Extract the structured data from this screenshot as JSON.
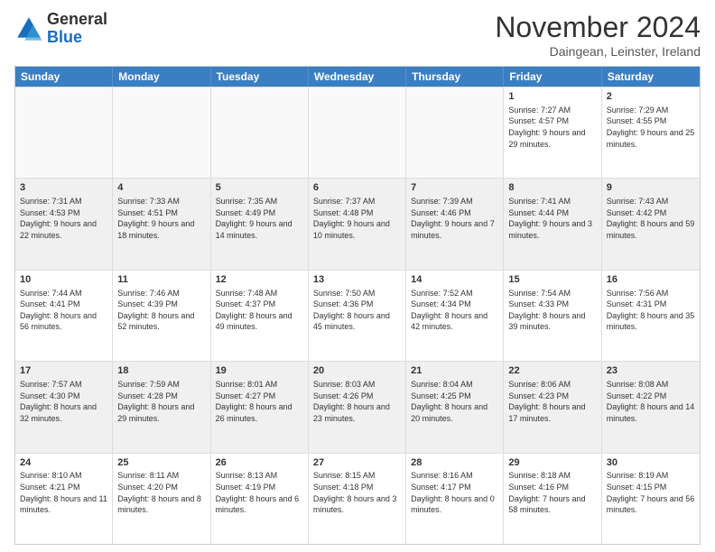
{
  "logo": {
    "general": "General",
    "blue": "Blue"
  },
  "header": {
    "month": "November 2024",
    "location": "Daingean, Leinster, Ireland"
  },
  "days": [
    "Sunday",
    "Monday",
    "Tuesday",
    "Wednesday",
    "Thursday",
    "Friday",
    "Saturday"
  ],
  "rows": [
    [
      {
        "day": "",
        "info": ""
      },
      {
        "day": "",
        "info": ""
      },
      {
        "day": "",
        "info": ""
      },
      {
        "day": "",
        "info": ""
      },
      {
        "day": "",
        "info": ""
      },
      {
        "day": "1",
        "info": "Sunrise: 7:27 AM\nSunset: 4:57 PM\nDaylight: 9 hours and 29 minutes."
      },
      {
        "day": "2",
        "info": "Sunrise: 7:29 AM\nSunset: 4:55 PM\nDaylight: 9 hours and 25 minutes."
      }
    ],
    [
      {
        "day": "3",
        "info": "Sunrise: 7:31 AM\nSunset: 4:53 PM\nDaylight: 9 hours and 22 minutes."
      },
      {
        "day": "4",
        "info": "Sunrise: 7:33 AM\nSunset: 4:51 PM\nDaylight: 9 hours and 18 minutes."
      },
      {
        "day": "5",
        "info": "Sunrise: 7:35 AM\nSunset: 4:49 PM\nDaylight: 9 hours and 14 minutes."
      },
      {
        "day": "6",
        "info": "Sunrise: 7:37 AM\nSunset: 4:48 PM\nDaylight: 9 hours and 10 minutes."
      },
      {
        "day": "7",
        "info": "Sunrise: 7:39 AM\nSunset: 4:46 PM\nDaylight: 9 hours and 7 minutes."
      },
      {
        "day": "8",
        "info": "Sunrise: 7:41 AM\nSunset: 4:44 PM\nDaylight: 9 hours and 3 minutes."
      },
      {
        "day": "9",
        "info": "Sunrise: 7:43 AM\nSunset: 4:42 PM\nDaylight: 8 hours and 59 minutes."
      }
    ],
    [
      {
        "day": "10",
        "info": "Sunrise: 7:44 AM\nSunset: 4:41 PM\nDaylight: 8 hours and 56 minutes."
      },
      {
        "day": "11",
        "info": "Sunrise: 7:46 AM\nSunset: 4:39 PM\nDaylight: 8 hours and 52 minutes."
      },
      {
        "day": "12",
        "info": "Sunrise: 7:48 AM\nSunset: 4:37 PM\nDaylight: 8 hours and 49 minutes."
      },
      {
        "day": "13",
        "info": "Sunrise: 7:50 AM\nSunset: 4:36 PM\nDaylight: 8 hours and 45 minutes."
      },
      {
        "day": "14",
        "info": "Sunrise: 7:52 AM\nSunset: 4:34 PM\nDaylight: 8 hours and 42 minutes."
      },
      {
        "day": "15",
        "info": "Sunrise: 7:54 AM\nSunset: 4:33 PM\nDaylight: 8 hours and 39 minutes."
      },
      {
        "day": "16",
        "info": "Sunrise: 7:56 AM\nSunset: 4:31 PM\nDaylight: 8 hours and 35 minutes."
      }
    ],
    [
      {
        "day": "17",
        "info": "Sunrise: 7:57 AM\nSunset: 4:30 PM\nDaylight: 8 hours and 32 minutes."
      },
      {
        "day": "18",
        "info": "Sunrise: 7:59 AM\nSunset: 4:28 PM\nDaylight: 8 hours and 29 minutes."
      },
      {
        "day": "19",
        "info": "Sunrise: 8:01 AM\nSunset: 4:27 PM\nDaylight: 8 hours and 26 minutes."
      },
      {
        "day": "20",
        "info": "Sunrise: 8:03 AM\nSunset: 4:26 PM\nDaylight: 8 hours and 23 minutes."
      },
      {
        "day": "21",
        "info": "Sunrise: 8:04 AM\nSunset: 4:25 PM\nDaylight: 8 hours and 20 minutes."
      },
      {
        "day": "22",
        "info": "Sunrise: 8:06 AM\nSunset: 4:23 PM\nDaylight: 8 hours and 17 minutes."
      },
      {
        "day": "23",
        "info": "Sunrise: 8:08 AM\nSunset: 4:22 PM\nDaylight: 8 hours and 14 minutes."
      }
    ],
    [
      {
        "day": "24",
        "info": "Sunrise: 8:10 AM\nSunset: 4:21 PM\nDaylight: 8 hours and 11 minutes."
      },
      {
        "day": "25",
        "info": "Sunrise: 8:11 AM\nSunset: 4:20 PM\nDaylight: 8 hours and 8 minutes."
      },
      {
        "day": "26",
        "info": "Sunrise: 8:13 AM\nSunset: 4:19 PM\nDaylight: 8 hours and 6 minutes."
      },
      {
        "day": "27",
        "info": "Sunrise: 8:15 AM\nSunset: 4:18 PM\nDaylight: 8 hours and 3 minutes."
      },
      {
        "day": "28",
        "info": "Sunrise: 8:16 AM\nSunset: 4:17 PM\nDaylight: 8 hours and 0 minutes."
      },
      {
        "day": "29",
        "info": "Sunrise: 8:18 AM\nSunset: 4:16 PM\nDaylight: 7 hours and 58 minutes."
      },
      {
        "day": "30",
        "info": "Sunrise: 8:19 AM\nSunset: 4:15 PM\nDaylight: 7 hours and 56 minutes."
      }
    ]
  ]
}
